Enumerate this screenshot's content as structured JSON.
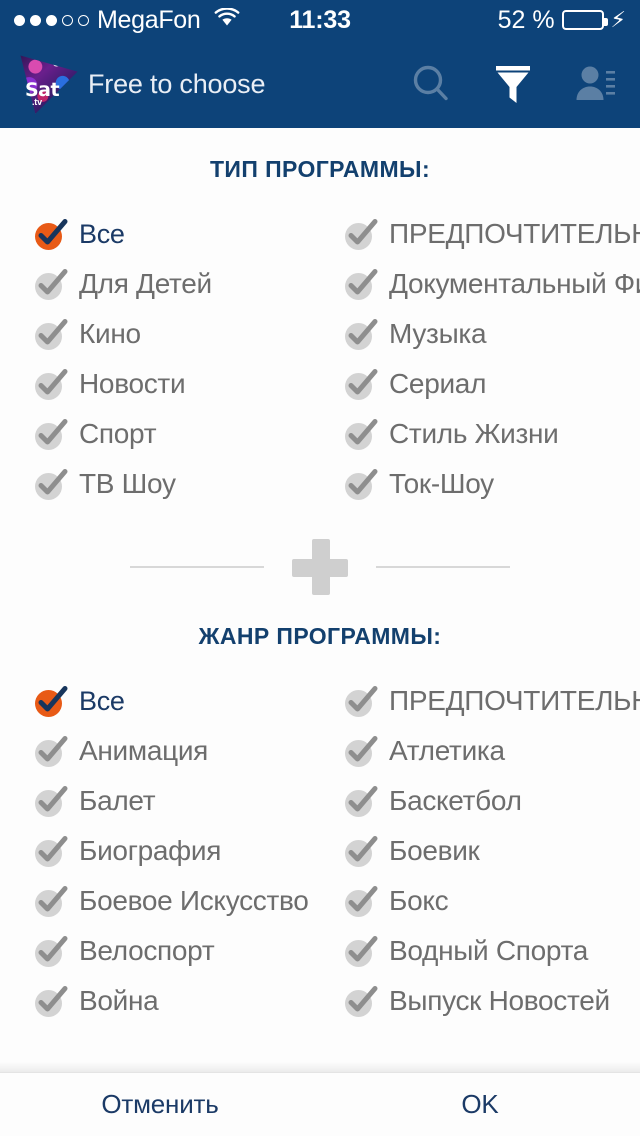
{
  "status_bar": {
    "signal_filled": 3,
    "signal_hollow": 2,
    "carrier": "MegaFon",
    "wifi_icon": "wifi-icon",
    "time": "11:33",
    "battery_percent": "52 %",
    "battery_level": 52,
    "charging_icon": "lightning-bolt-icon"
  },
  "app_bar": {
    "logo_name": "sat-tv-logo",
    "logo_primary_text": "Sat",
    "logo_secondary_text": ".tv",
    "tagline": "Free to choose",
    "actions": [
      {
        "name": "search-icon",
        "label": "search",
        "active": false
      },
      {
        "name": "filter-icon",
        "label": "filter",
        "active": true
      },
      {
        "name": "profile-icon",
        "label": "profile",
        "active": false
      }
    ]
  },
  "sections": [
    {
      "title": "ТИП ПРОГРАММЫ:",
      "left_items": [
        {
          "label": "Все",
          "checked": true
        },
        {
          "label": "Для Детей",
          "checked": false
        },
        {
          "label": "Кино",
          "checked": false
        },
        {
          "label": "Новости",
          "checked": false
        },
        {
          "label": "Спорт",
          "checked": false
        },
        {
          "label": "ТВ Шоу",
          "checked": false
        }
      ],
      "right_items": [
        {
          "label": "ПРЕДПОЧТИТЕЛЬНЫЙ",
          "checked": false
        },
        {
          "label": "Документальный Фильм",
          "checked": false
        },
        {
          "label": "Музыка",
          "checked": false
        },
        {
          "label": "Сериал",
          "checked": false
        },
        {
          "label": "Стиль Жизни",
          "checked": false
        },
        {
          "label": "Ток-Шоу",
          "checked": false
        }
      ]
    },
    {
      "title": "ЖАНР ПРОГРАММЫ:",
      "left_items": [
        {
          "label": "Все",
          "checked": true
        },
        {
          "label": "Анимация",
          "checked": false
        },
        {
          "label": "Балет",
          "checked": false
        },
        {
          "label": "Биография",
          "checked": false
        },
        {
          "label": "Боевое Искусство",
          "checked": false
        },
        {
          "label": "Велоспорт",
          "checked": false
        },
        {
          "label": "Война",
          "checked": false
        }
      ],
      "right_items": [
        {
          "label": "ПРЕДПОЧТИТЕЛЬНЫЙ",
          "checked": false
        },
        {
          "label": "Атлетика",
          "checked": false
        },
        {
          "label": "Баскетбол",
          "checked": false
        },
        {
          "label": "Боевик",
          "checked": false
        },
        {
          "label": "Бокс",
          "checked": false
        },
        {
          "label": "Водный Спорта",
          "checked": false
        },
        {
          "label": "Выпуск Новостей",
          "checked": false
        }
      ]
    }
  ],
  "divider": {
    "icon": "plus-icon"
  },
  "bottom_bar": {
    "cancel_label": "Отменить",
    "ok_label": "OK"
  },
  "colors": {
    "header_blue": "#0d4379",
    "accent_orange": "#e85a16",
    "text_blue": "#1b3a66",
    "title_blue": "#13406e",
    "muted_gray": "#6d6d6d",
    "checkbox_gray": "#d3d3d3",
    "battery_yellow": "#f6c513",
    "page_bg": "#fdfdfd"
  }
}
